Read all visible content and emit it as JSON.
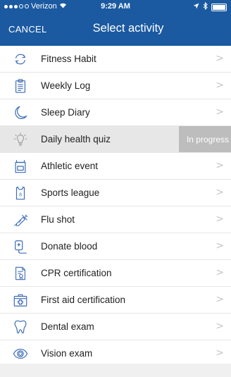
{
  "status": {
    "carrier": "Verizon",
    "time": "9:29 AM"
  },
  "nav": {
    "cancel": "CANCEL",
    "title": "Select activity"
  },
  "colors": {
    "header": "#1b5aa1",
    "accent": "#3d6cb5",
    "badge": "#bdbdbd"
  },
  "items": [
    {
      "label": "Fitness Habit",
      "icon": "refresh-icon"
    },
    {
      "label": "Weekly Log",
      "icon": "clipboard-icon"
    },
    {
      "label": "Sleep Diary",
      "icon": "moon-icon"
    },
    {
      "label": "Daily health quiz",
      "icon": "lightbulb-icon",
      "status": "In progress"
    },
    {
      "label": "Athletic event",
      "icon": "athletic-bib-icon"
    },
    {
      "label": "Sports league",
      "icon": "jersey-icon"
    },
    {
      "label": "Flu shot",
      "icon": "syringe-icon"
    },
    {
      "label": "Donate blood",
      "icon": "blood-bag-icon"
    },
    {
      "label": "CPR certification",
      "icon": "certificate-icon"
    },
    {
      "label": "First aid certification",
      "icon": "first-aid-kit-icon"
    },
    {
      "label": "Dental exam",
      "icon": "tooth-icon"
    },
    {
      "label": "Vision exam",
      "icon": "eye-icon"
    }
  ]
}
